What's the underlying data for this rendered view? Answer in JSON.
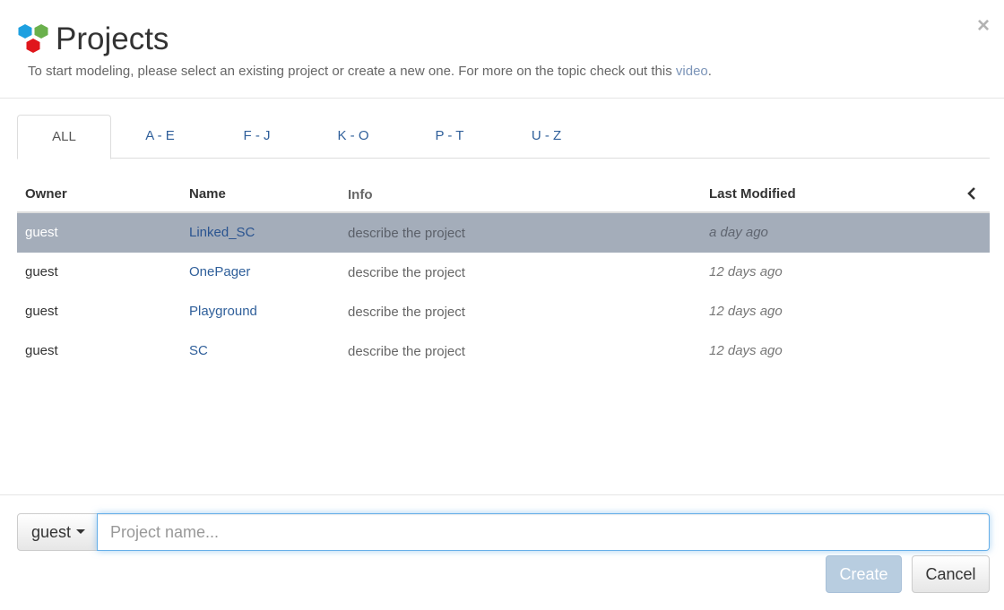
{
  "header": {
    "title": "Projects",
    "subtitle_prefix": "To start modeling, please select an existing project or create a new one. For more on the topic check out this ",
    "subtitle_link": "video",
    "subtitle_suffix": ".",
    "close_label": "×"
  },
  "tabs": [
    {
      "label": "ALL",
      "active": true
    },
    {
      "label": "A - E"
    },
    {
      "label": "F - J"
    },
    {
      "label": "K - O"
    },
    {
      "label": "P - T"
    },
    {
      "label": "U - Z"
    }
  ],
  "table": {
    "columns": {
      "owner": "Owner",
      "name": "Name",
      "info": "Info",
      "modified": "Last Modified"
    },
    "rows": [
      {
        "owner": "guest",
        "name": "Linked_SC",
        "info": "describe the project",
        "modified": "a day ago",
        "selected": true
      },
      {
        "owner": "guest",
        "name": "OnePager",
        "info": "describe the project",
        "modified": "12 days ago"
      },
      {
        "owner": "guest",
        "name": "Playground",
        "info": "describe the project",
        "modified": "12 days ago"
      },
      {
        "owner": "guest",
        "name": "SC",
        "info": "describe the project",
        "modified": "12 days ago"
      }
    ]
  },
  "footer": {
    "owner_selected": "guest",
    "name_placeholder": "Project name...",
    "name_value": "",
    "create_label": "Create",
    "cancel_label": "Cancel"
  },
  "colors": {
    "selected_row": "#a4adba",
    "link": "#2f5f9a",
    "logo_blue": "#1ea0e0",
    "logo_green": "#6ab04c",
    "logo_red": "#e0161c"
  },
  "icons": {
    "logo": "hexagon-cluster-icon",
    "close": "close-icon",
    "collapse": "chevron-left-icon",
    "dropdown": "caret-down-icon"
  }
}
